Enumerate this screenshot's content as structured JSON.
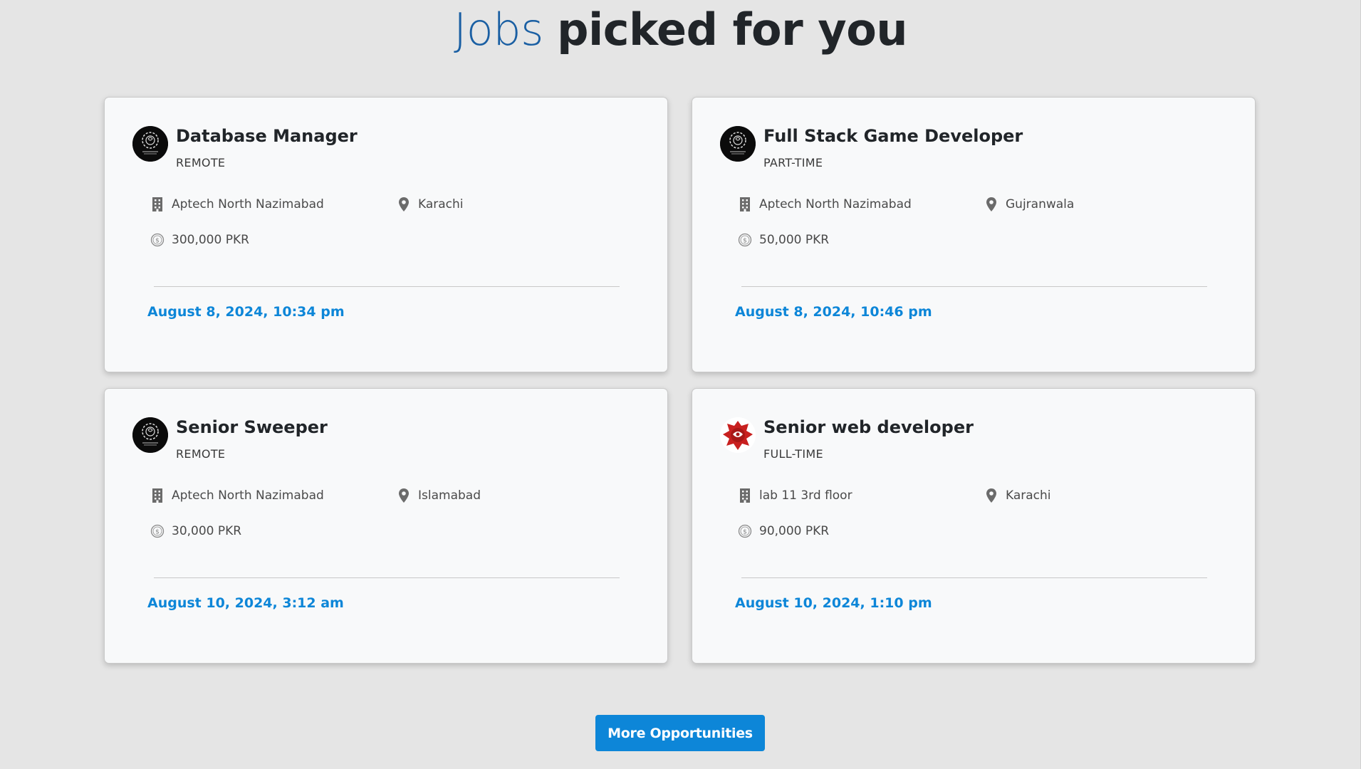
{
  "heading": {
    "light": "Jobs",
    "bold": "picked for you"
  },
  "jobs": [
    {
      "title": "Database Manager",
      "type": "REMOTE",
      "company": "Aptech North Nazimabad",
      "location": "Karachi",
      "salary": "300,000 PKR",
      "date": "August 8, 2024, 10:34 pm",
      "logo": "gear-brain-logo"
    },
    {
      "title": "Full Stack Game Developer",
      "type": "PART-TIME",
      "company": "Aptech North Nazimabad",
      "location": "Gujranwala",
      "salary": "50,000 PKR",
      "date": "August 8, 2024, 10:46 pm",
      "logo": "gear-brain-logo"
    },
    {
      "title": "Senior Sweeper",
      "type": "REMOTE",
      "company": "Aptech North Nazimabad",
      "location": "Islamabad",
      "salary": "30,000 PKR",
      "date": "August 10, 2024, 3:12 am",
      "logo": "gear-brain-logo"
    },
    {
      "title": "Senior web developer",
      "type": "FULL-TIME",
      "company": "lab 11 3rd floor",
      "location": "Karachi",
      "salary": "90,000 PKR",
      "date": "August 10, 2024, 1:10 pm",
      "logo": "red-splash-logo"
    }
  ],
  "more_button_label": "More Opportunities",
  "colors": {
    "accent": "#0d86d8",
    "heading_light": "#1a5fa3",
    "background": "#e5e5e5",
    "card": "#f8f9fa"
  }
}
